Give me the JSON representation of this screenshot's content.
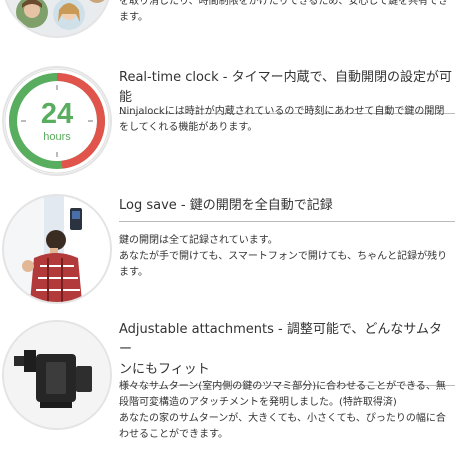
{
  "sections": {
    "top": {
      "body_lines": [
        "を取り消したり、時間制限をかけたりできるため、安心して鍵を共有でき",
        "ます。"
      ]
    },
    "clock": {
      "title": "Real-time clock - タイマー内蔵で、自動開閉の設定が可能",
      "clock_number": "24",
      "clock_unit": "hours",
      "body_lines": [
        "Ninjalockには時計が内蔵されているので時刻にあわせて自動で鍵の開閉",
        "をしてくれる機能があります。"
      ]
    },
    "log": {
      "title": "Log save - 鍵の開閉を全自動で記録",
      "body_lines": [
        "鍵の開閉は全て記録されています。",
        "あなたが手で開けても、スマートフォンで開けても、ちゃんと記録が残り",
        "ます。"
      ]
    },
    "adjust": {
      "title_line1": "Adjustable attachments - 調整可能で、どんなサムター",
      "title_line2": "ンにもフィット",
      "body_lines": [
        "様々なサムターン(室内側の鍵のツマミ部分)に合わせることができる、無",
        "段階可変構造のアタッチメントを発明しました。(特許取得済)",
        "あなたの家のサムターンが、大きくても、小さくても、ぴったりの幅に合",
        "わせることができます。"
      ]
    }
  },
  "colors": {
    "clock_green": "#59ad5e",
    "clock_red": "#e0544c",
    "divider": "#bbbbbb"
  }
}
